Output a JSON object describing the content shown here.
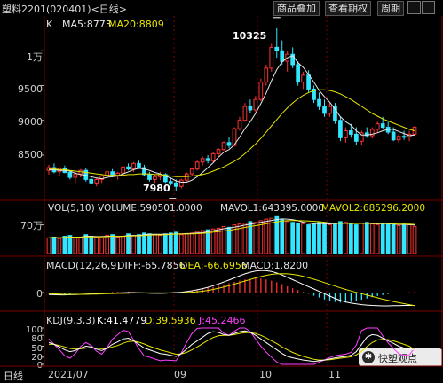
{
  "header": {
    "title": "塑料2201(020401)<日线>",
    "buttons": [
      "商品叠加",
      "查看期权",
      "周期"
    ]
  },
  "price_panel": {
    "k_label": "K",
    "ma5_label": "MA5:8773",
    "ma20_label": "MA20:8809",
    "y_ticks": [
      "1万",
      "9500",
      "9000",
      "8500"
    ],
    "high_annotation": "10325",
    "low_annotation": "7980"
  },
  "vol_panel": {
    "vol_label": "VOL(5,10) VOLUME:590501.0000",
    "mavol1_label": "MAVOL1:643395.0000",
    "mavol2_label": "MAVOL2:685296.2000",
    "y_tick": "70万"
  },
  "macd_panel": {
    "macd_label": "MACD(12,26,9)",
    "diff_label": "DIFF:-65.7856",
    "dea_label": "DEA:-66.6956",
    "macd_value_label": "MACD:1.8200",
    "y_tick": "0"
  },
  "kdj_panel": {
    "kdj_label": "KDJ(9,3,3)",
    "k_label": "K:41.4779",
    "d_label": "D:39.5936",
    "j_label": "J:45.2466",
    "y_ticks": [
      "100",
      "80",
      "50",
      "20",
      "0"
    ]
  },
  "x_axis": {
    "period_label": "日线",
    "dates": [
      "2021/07",
      "09",
      "10",
      "11"
    ]
  },
  "watermark": {
    "text": "快塑观点"
  },
  "colors": {
    "up": "#ff3232",
    "down": "#32e6ff",
    "ma5": "#e8e8e8",
    "ma20": "#e6e600",
    "mavol2": "#e6e600",
    "dea_line": "#e6e600",
    "j_line": "#ff40ff",
    "grid": "#7a0000",
    "kdj_k": "#ffffff",
    "kdj_d": "#e6e600"
  },
  "chart_data": {
    "type": "candlestick",
    "price_range": [
      7900,
      10450
    ],
    "candles": [
      [
        8280,
        8360,
        8220,
        8320
      ],
      [
        8320,
        8380,
        8240,
        8260
      ],
      [
        8260,
        8330,
        8200,
        8310
      ],
      [
        8310,
        8350,
        8240,
        8250
      ],
      [
        8250,
        8280,
        8150,
        8180
      ],
      [
        8180,
        8260,
        8100,
        8230
      ],
      [
        8230,
        8300,
        8180,
        8280
      ],
      [
        8280,
        8320,
        8120,
        8150
      ],
      [
        8150,
        8200,
        8080,
        8100
      ],
      [
        8100,
        8180,
        8050,
        8150
      ],
      [
        8150,
        8220,
        8100,
        8200
      ],
      [
        8200,
        8280,
        8170,
        8260
      ],
      [
        8260,
        8300,
        8180,
        8200
      ],
      [
        8200,
        8260,
        8150,
        8240
      ],
      [
        8240,
        8350,
        8220,
        8330
      ],
      [
        8330,
        8380,
        8280,
        8300
      ],
      [
        8300,
        8400,
        8260,
        8380
      ],
      [
        8380,
        8420,
        8300,
        8320
      ],
      [
        8320,
        8360,
        8200,
        8220
      ],
      [
        8220,
        8260,
        8120,
        8150
      ],
      [
        8150,
        8220,
        8100,
        8190
      ],
      [
        8190,
        8260,
        8140,
        8220
      ],
      [
        8220,
        8240,
        8100,
        8120
      ],
      [
        8120,
        8180,
        8060,
        8100
      ],
      [
        8100,
        8150,
        7980,
        8050
      ],
      [
        8050,
        8160,
        8020,
        8140
      ],
      [
        8140,
        8250,
        8120,
        8230
      ],
      [
        8230,
        8320,
        8200,
        8300
      ],
      [
        8300,
        8420,
        8280,
        8400
      ],
      [
        8400,
        8480,
        8350,
        8450
      ],
      [
        8450,
        8500,
        8380,
        8420
      ],
      [
        8420,
        8550,
        8400,
        8520
      ],
      [
        8520,
        8600,
        8480,
        8580
      ],
      [
        8580,
        8700,
        8560,
        8680
      ],
      [
        8680,
        8760,
        8600,
        8640
      ],
      [
        8640,
        8900,
        8620,
        8880
      ],
      [
        8880,
        9050,
        8850,
        9000
      ],
      [
        9000,
        9250,
        8980,
        9200
      ],
      [
        9200,
        9300,
        9100,
        9150
      ],
      [
        9150,
        9350,
        9120,
        9300
      ],
      [
        9300,
        9600,
        9280,
        9550
      ],
      [
        9550,
        9800,
        9500,
        9750
      ],
      [
        9750,
        10100,
        9700,
        10050
      ],
      [
        10050,
        10325,
        9900,
        10000
      ],
      [
        10000,
        10150,
        9800,
        9850
      ],
      [
        9850,
        10000,
        9700,
        9950
      ],
      [
        9950,
        10050,
        9750,
        9800
      ],
      [
        9800,
        9850,
        9500,
        9550
      ],
      [
        9550,
        9700,
        9450,
        9650
      ],
      [
        9650,
        9720,
        9400,
        9450
      ],
      [
        9450,
        9500,
        9250,
        9300
      ],
      [
        9300,
        9400,
        9150,
        9200
      ],
      [
        9200,
        9300,
        9050,
        9100
      ],
      [
        9100,
        9250,
        9050,
        9200
      ],
      [
        9200,
        9250,
        8950,
        9000
      ],
      [
        9000,
        9050,
        8700,
        8750
      ],
      [
        8750,
        8900,
        8680,
        8850
      ],
      [
        8850,
        8950,
        8750,
        8800
      ],
      [
        8800,
        8900,
        8650,
        8700
      ],
      [
        8700,
        8850,
        8650,
        8820
      ],
      [
        8820,
        8900,
        8750,
        8780
      ],
      [
        8780,
        8900,
        8740,
        8870
      ],
      [
        8870,
        8980,
        8820,
        8950
      ],
      [
        8950,
        9050,
        8880,
        8900
      ],
      [
        8900,
        8980,
        8800,
        8830
      ],
      [
        8830,
        8900,
        8700,
        8720
      ],
      [
        8720,
        8800,
        8680,
        8770
      ],
      [
        8770,
        8850,
        8720,
        8760
      ],
      [
        8760,
        8850,
        8700,
        8800
      ],
      [
        8800,
        8920,
        8780,
        8900
      ]
    ],
    "ma5": [
      8290,
      8290,
      8280,
      8280,
      8270,
      8240,
      8220,
      8210,
      8190,
      8170,
      8160,
      8180,
      8190,
      8200,
      8230,
      8260,
      8290,
      8310,
      8300,
      8280,
      8250,
      8230,
      8200,
      8170,
      8130,
      8110,
      8110,
      8140,
      8190,
      8250,
      8320,
      8390,
      8470,
      8540,
      8580,
      8650,
      8760,
      8880,
      8980,
      9100,
      9240,
      9390,
      9570,
      9730,
      9840,
      9900,
      9930,
      9830,
      9760,
      9660,
      9550,
      9430,
      9340,
      9260,
      9160,
      9050,
      8980,
      8930,
      8850,
      8790,
      8790,
      8800,
      8820,
      8850,
      8870,
      8870,
      8840,
      8810,
      8780,
      8790
    ],
    "ma20": [
      8300,
      8300,
      8290,
      8290,
      8280,
      8270,
      8260,
      8250,
      8240,
      8230,
      8220,
      8210,
      8210,
      8210,
      8210,
      8220,
      8220,
      8230,
      8230,
      8230,
      8220,
      8220,
      8210,
      8200,
      8190,
      8190,
      8190,
      8200,
      8210,
      8220,
      8240,
      8270,
      8300,
      8330,
      8370,
      8410,
      8460,
      8520,
      8590,
      8660,
      8740,
      8830,
      8920,
      9010,
      9100,
      9180,
      9250,
      9310,
      9360,
      9400,
      9430,
      9440,
      9440,
      9430,
      9410,
      9380,
      9340,
      9300,
      9250,
      9200,
      9150,
      9100,
      9060,
      9020,
      8990,
      8960,
      8930,
      8900,
      8870,
      8850
    ],
    "volume": [
      38,
      40,
      36,
      42,
      44,
      38,
      40,
      46,
      42,
      40,
      38,
      44,
      46,
      40,
      42,
      48,
      44,
      46,
      50,
      48,
      46,
      44,
      48,
      50,
      52,
      46,
      48,
      50,
      54,
      56,
      58,
      60,
      62,
      66,
      64,
      70,
      72,
      74,
      78,
      76,
      80,
      84,
      86,
      90,
      82,
      78,
      76,
      74,
      72,
      70,
      74,
      76,
      72,
      70,
      74,
      78,
      76,
      72,
      70,
      74,
      76,
      72,
      70,
      74,
      72,
      70,
      68,
      72,
      70,
      66
    ],
    "macd_hist": [
      -4,
      -5,
      -6,
      -6,
      -5,
      -4,
      -3,
      -2,
      -2,
      -1,
      0,
      1,
      2,
      2,
      3,
      3,
      2,
      1,
      0,
      -1,
      -2,
      -2,
      -1,
      0,
      1,
      2,
      4,
      6,
      9,
      12,
      15,
      18,
      22,
      26,
      30,
      34,
      38,
      42,
      44,
      46,
      45,
      42,
      38,
      33,
      27,
      20,
      14,
      8,
      2,
      -4,
      -10,
      -16,
      -22,
      -27,
      -30,
      -32,
      -32,
      -30,
      -27,
      -23,
      -19,
      -15,
      -11,
      -8,
      -5,
      -3,
      -1,
      0,
      1,
      2
    ],
    "diff": [
      -10,
      -11,
      -12,
      -12,
      -11,
      -10,
      -9,
      -8,
      -7,
      -6,
      -5,
      -4,
      -3,
      -2,
      -1,
      0,
      0,
      -1,
      -2,
      -3,
      -4,
      -4,
      -3,
      -2,
      0,
      2,
      5,
      9,
      14,
      20,
      27,
      35,
      44,
      54,
      64,
      75,
      86,
      96,
      104,
      110,
      113,
      112,
      108,
      100,
      90,
      78,
      66,
      54,
      42,
      30,
      18,
      6,
      -6,
      -18,
      -30,
      -40,
      -48,
      -54,
      -58,
      -62,
      -64,
      -66,
      -67,
      -68,
      -68,
      -67,
      -67,
      -66,
      -66,
      -66
    ],
    "dea": [
      -6,
      -7,
      -8,
      -9,
      -9,
      -9,
      -9,
      -9,
      -8,
      -8,
      -7,
      -6,
      -5,
      -4,
      -4,
      -3,
      -2,
      -2,
      -2,
      -2,
      -2,
      -2,
      -2,
      -2,
      -2,
      -1,
      0,
      2,
      4,
      7,
      11,
      16,
      22,
      28,
      35,
      43,
      51,
      59,
      67,
      75,
      82,
      88,
      93,
      96,
      97,
      96,
      93,
      89,
      83,
      76,
      68,
      60,
      51,
      42,
      33,
      24,
      16,
      8,
      1,
      -6,
      -13,
      -20,
      -27,
      -34,
      -40,
      -46,
      -52,
      -57,
      -62,
      -67
    ],
    "kdj_k": [
      60,
      55,
      48,
      40,
      35,
      38,
      45,
      50,
      48,
      42,
      38,
      45,
      55,
      62,
      70,
      72,
      65,
      55,
      45,
      40,
      35,
      30,
      28,
      25,
      22,
      30,
      42,
      55,
      65,
      75,
      85,
      90,
      88,
      82,
      80,
      85,
      90,
      92,
      88,
      80,
      70,
      60,
      50,
      40,
      30,
      22,
      18,
      15,
      12,
      10,
      8,
      10,
      12,
      15,
      18,
      20,
      22,
      25,
      35,
      55,
      75,
      82,
      80,
      72,
      65,
      58,
      50,
      45,
      42,
      41
    ],
    "kdj_d": [
      55,
      55,
      52,
      48,
      44,
      42,
      43,
      45,
      46,
      45,
      43,
      44,
      48,
      52,
      58,
      63,
      64,
      61,
      56,
      50,
      45,
      40,
      36,
      32,
      28,
      29,
      33,
      40,
      48,
      57,
      66,
      74,
      79,
      80,
      80,
      82,
      85,
      87,
      87,
      85,
      80,
      73,
      65,
      57,
      48,
      40,
      33,
      27,
      22,
      18,
      14,
      12,
      12,
      13,
      15,
      17,
      19,
      21,
      26,
      36,
      49,
      60,
      67,
      69,
      68,
      65,
      60,
      55,
      50,
      40
    ],
    "kdj_j": [
      70,
      55,
      40,
      24,
      17,
      30,
      49,
      60,
      52,
      36,
      28,
      47,
      69,
      82,
      94,
      90,
      67,
      43,
      23,
      20,
      15,
      10,
      12,
      11,
      10,
      32,
      60,
      85,
      99,
      100,
      100,
      100,
      100,
      86,
      80,
      91,
      100,
      100,
      90,
      70,
      50,
      34,
      20,
      6,
      0,
      0,
      0,
      0,
      0,
      0,
      0,
      6,
      12,
      19,
      24,
      26,
      28,
      33,
      53,
      93,
      100,
      100,
      100,
      78,
      59,
      44,
      30,
      25,
      26,
      45
    ]
  }
}
